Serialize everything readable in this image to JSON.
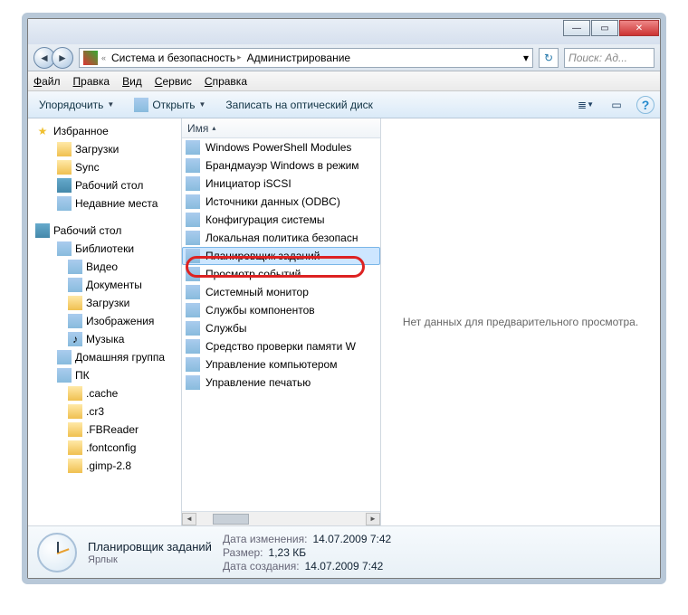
{
  "window_controls": {
    "min": "—",
    "max": "▭",
    "close": "✕"
  },
  "breadcrumb": {
    "root_icon": "shield-icon",
    "segments": [
      "Система и безопасность",
      "Администрирование"
    ]
  },
  "search": {
    "placeholder": "Поиск: Ад..."
  },
  "menu": {
    "file": "Файл",
    "edit": "Правка",
    "view": "Вид",
    "tools": "Сервис",
    "help": "Справка"
  },
  "toolbar": {
    "organize": "Упорядочить",
    "open": "Открыть",
    "burn": "Записать на оптический диск"
  },
  "nav": {
    "favorites": {
      "label": "Избранное",
      "items": [
        "Загрузки",
        "Sync",
        "Рабочий стол",
        "Недавние места"
      ]
    },
    "desktop": {
      "label": "Рабочий стол",
      "libraries": {
        "label": "Библиотеки",
        "items": [
          "Видео",
          "Документы",
          "Загрузки",
          "Изображения",
          "Музыка"
        ]
      },
      "homegroup": "Домашняя группа",
      "pc": {
        "label": "ПК",
        "items": [
          ".cache",
          ".cr3",
          ".FBReader",
          ".fontconfig",
          ".gimp-2.8"
        ]
      }
    }
  },
  "column_header": "Имя",
  "items": [
    "Windows PowerShell Modules",
    "Брандмауэр Windows в режим",
    "Инициатор iSCSI",
    "Источники данных (ODBC)",
    "Конфигурация системы",
    "Локальная политика безопасн",
    "Планировщик заданий",
    "Просмотр событий",
    "Системный монитор",
    "Службы компонентов",
    "Службы",
    "Средство проверки памяти W",
    "Управление компьютером",
    "Управление печатью"
  ],
  "selected_index": 6,
  "preview_text": "Нет данных для предварительного просмотра.",
  "details": {
    "name": "Планировщик заданий",
    "type": "Ярлык",
    "rows": [
      {
        "label": "Дата изменения:",
        "value": "14.07.2009 7:42"
      },
      {
        "label": "Размер:",
        "value": "1,23 КБ"
      },
      {
        "label": "Дата создания:",
        "value": "14.07.2009 7:42"
      }
    ]
  }
}
